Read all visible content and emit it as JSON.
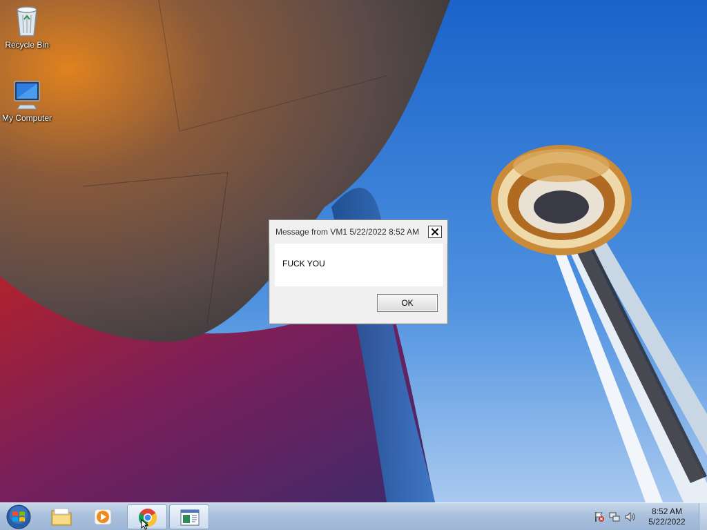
{
  "desktop": {
    "icons": [
      {
        "label": "Recycle Bin",
        "icon": "recycle-bin-icon"
      },
      {
        "label": "My Computer",
        "icon": "computer-icon"
      }
    ]
  },
  "dialog": {
    "title": "Message from VM1 5/22/2022 8:52 AM",
    "message": "FUCK YOU",
    "ok_label": "OK",
    "close_glyph": "✕"
  },
  "taskbar": {
    "items": [
      {
        "icon": "windows-start-icon"
      },
      {
        "icon": "folder-icon"
      },
      {
        "icon": "media-player-icon"
      },
      {
        "icon": "chrome-icon",
        "active": true
      },
      {
        "icon": "application-window-icon",
        "active": true
      }
    ],
    "tray": {
      "icons": [
        "action-center-flag-icon",
        "network-icon",
        "volume-icon"
      ],
      "time": "8:52 AM",
      "date": "5/22/2022"
    }
  },
  "colors": {
    "sky": "#1f6fd1",
    "taskbar": "#a9c0dc",
    "dialog_bg": "#f0f0f0"
  }
}
